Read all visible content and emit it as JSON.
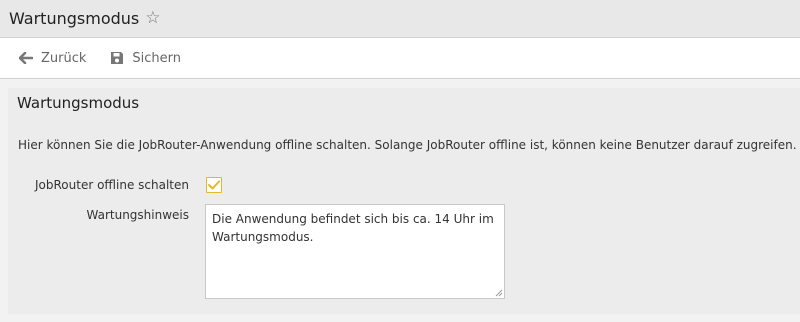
{
  "header": {
    "title": "Wartungsmodus",
    "star_icon": "star-outline-icon"
  },
  "toolbar": {
    "back_label": "Zurück",
    "back_icon": "arrow-left-icon",
    "save_label": "Sichern",
    "save_icon": "floppy-disk-icon"
  },
  "panel": {
    "title": "Wartungsmodus",
    "description": "Hier können Sie die JobRouter-Anwendung offline schalten. Solange JobRouter offline ist, können keine Benutzer darauf zugreifen.",
    "offline_label": "JobRouter offline schalten",
    "offline_checked": true,
    "hint_label": "Wartungshinweis",
    "hint_value": "Die Anwendung befindet sich bis ca. 14 Uhr im Wartungsmodus."
  },
  "colors": {
    "checkbox_accent": "#e7b726"
  }
}
